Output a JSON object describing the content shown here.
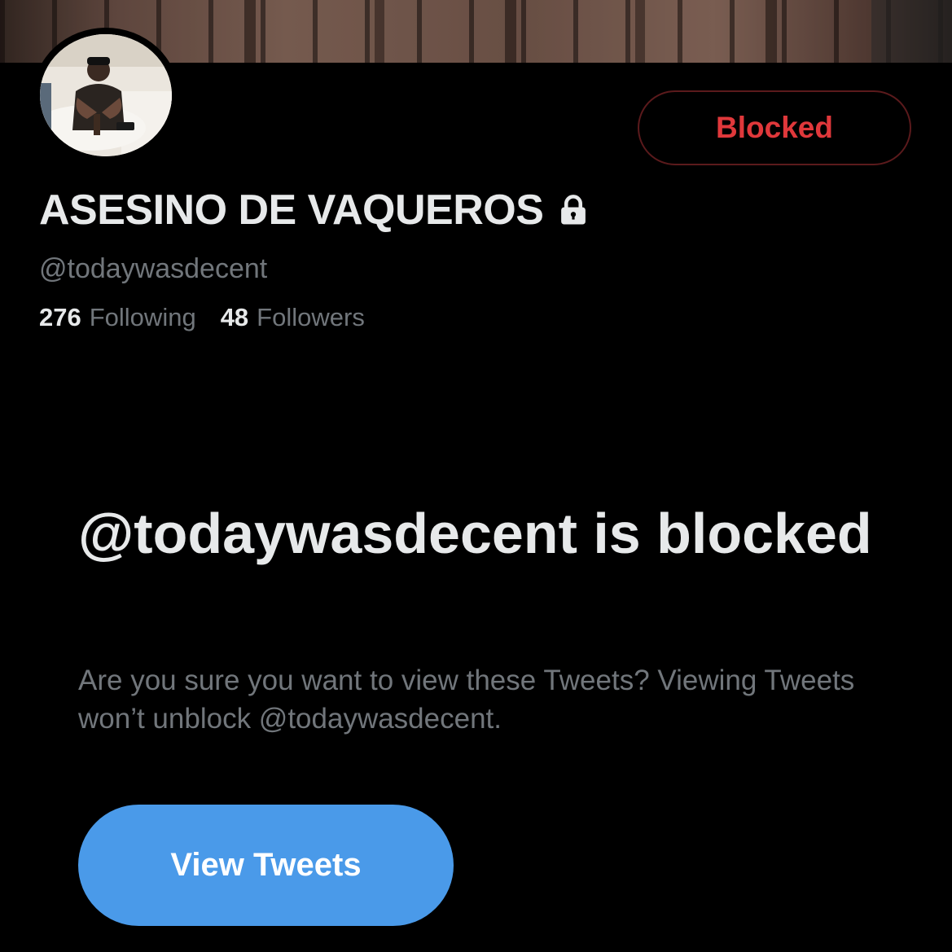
{
  "profile": {
    "display_name": "ASESINO DE VAQUEROS",
    "handle": "@todaywasdecent",
    "locked_icon": "lock-icon",
    "following_count": "276",
    "following_label": "Following",
    "followers_count": "48",
    "followers_label": "Followers"
  },
  "actions": {
    "blocked_label": "Blocked",
    "blocked_color": "#e0383b"
  },
  "blocked_notice": {
    "title": "@todaywasdecent is blocked",
    "description": "Are you sure you want to view these Tweets? Viewing Tweets won’t unblock @todaywasdecent.",
    "view_button_label": "View Tweets",
    "view_button_color": "#4a9ae9"
  }
}
